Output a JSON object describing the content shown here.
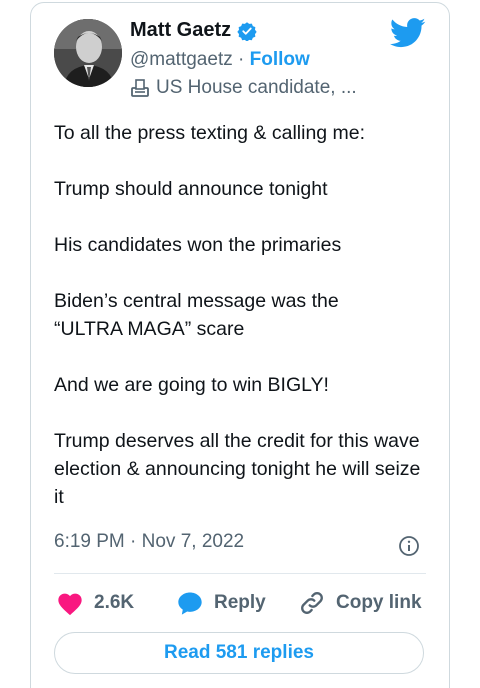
{
  "author": {
    "name": "Matt Gaetz",
    "handle": "@mattgaetz",
    "separator": "·",
    "follow_label": "Follow",
    "label": "US House candidate, ...",
    "avatar_icon": "user-avatar"
  },
  "tweet": {
    "lines": [
      "To all the press texting & calling me:",
      "Trump should announce tonight",
      "His candidates won the primaries",
      "Biden’s central message was the “ULTRA MAGA” scare",
      "And we are going to win BIGLY!",
      "Trump deserves all the credit for this wave election & announcing tonight he will seize it"
    ],
    "timestamp": "6:19 PM · Nov 7, 2022"
  },
  "actions": {
    "likes": "2.6K",
    "reply_label": "Reply",
    "copy_link_label": "Copy link"
  },
  "read_replies_label": "Read 581 replies",
  "colors": {
    "accent": "#1d9bf0",
    "like": "#f91880",
    "muted": "#536471"
  }
}
